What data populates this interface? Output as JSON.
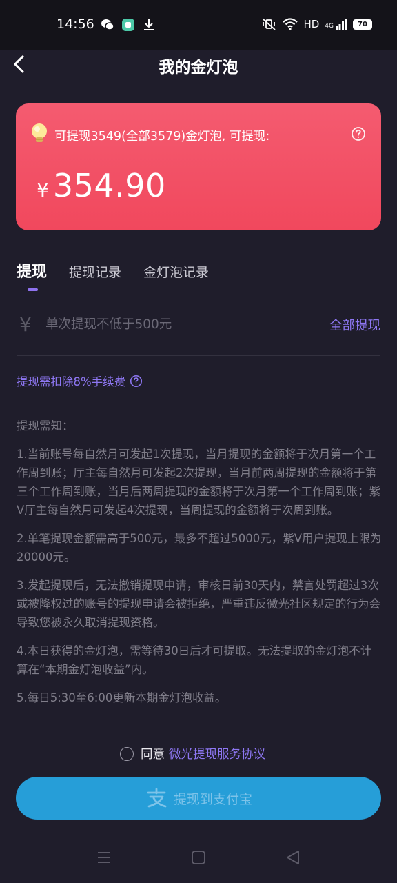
{
  "status_bar": {
    "time": "14:56",
    "network": "HD",
    "signal_label": "4G",
    "battery": "70"
  },
  "header": {
    "title": "我的金灯泡"
  },
  "card": {
    "summary": "可提现3549(全部3579)金灯泡, 可提现:",
    "currency_symbol": "¥",
    "amount": "354.90",
    "background_color": "#f1485d"
  },
  "tabs": [
    {
      "label": "提现",
      "active": true
    },
    {
      "label": "提现记录",
      "active": false
    },
    {
      "label": "金灯泡记录",
      "active": false
    }
  ],
  "input": {
    "currency_symbol": "¥",
    "placeholder": "单次提现不低于500元",
    "value": "",
    "withdraw_all_label": "全部提现"
  },
  "fee": {
    "text": "提现需扣除8%手续费"
  },
  "notes": {
    "title": "提现需知：",
    "items": [
      "1.当前账号每自然月可发起1次提现，当月提现的金额将于次月第一个工作周到账；厅主每自然月可发起2次提现，当月前两周提现的金额将于第三个工作周到账，当月后两周提现的金额将于次月第一个工作周到账；紫V厅主每自然月可发起4次提现，当周提现的金额将于次周到账。",
      "2.单笔提现金额需高于500元，最多不超过5000元，紫V用户提现上限为20000元。",
      "3.发起提现后，无法撤销提现申请，审核日前30天内，禁言处罚超过3次或被降权过的账号的提现申请会被拒绝，严重违反微光社区规定的行为会导致您被永久取消提现资格。",
      "4.本日获得的金灯泡，需等待30日后才可提取。无法提取的金灯泡不计算在“本期金灯泡收益”内。",
      "5.每日5:30至6:00更新本期金灯泡收益。"
    ]
  },
  "agreement": {
    "prefix": "同意",
    "link": "微光提现服务协议",
    "checked": false
  },
  "submit": {
    "label": "提现到支付宝",
    "color": "#269ed8"
  },
  "accent_color": "#8e77f3"
}
